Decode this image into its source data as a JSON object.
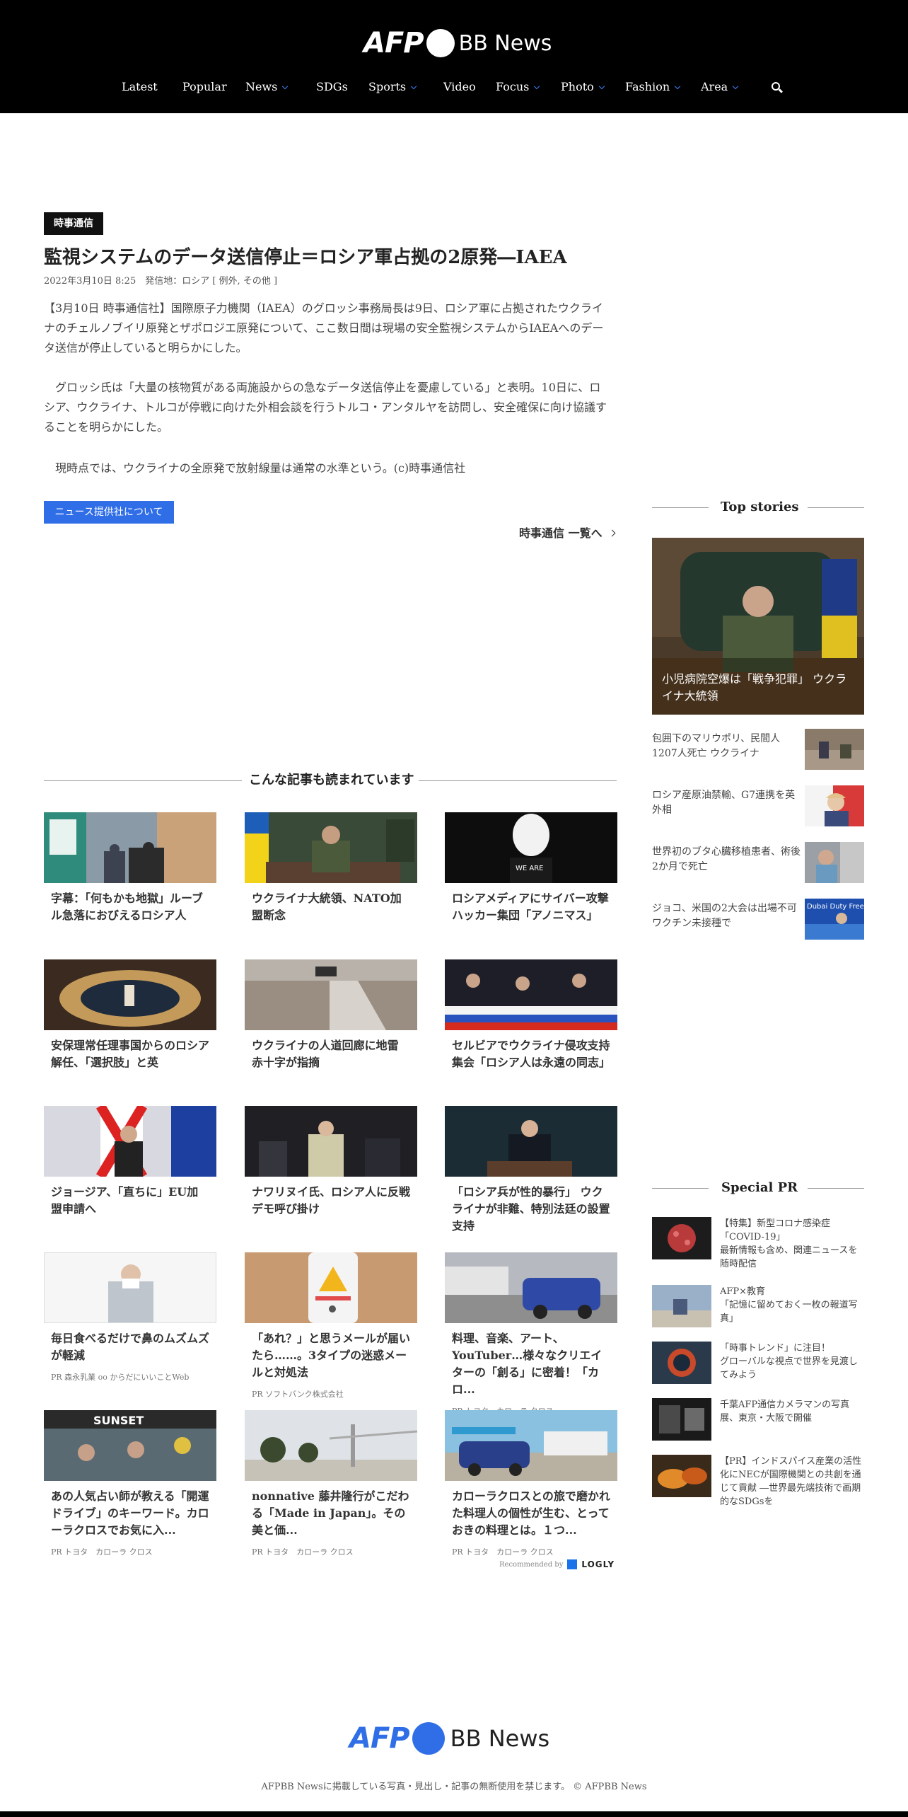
{
  "header": {
    "logo": {
      "afp": "AFP",
      "bb": "BB News"
    },
    "nav": [
      {
        "label": "Latest",
        "dropdown": false
      },
      {
        "label": "Popular",
        "dropdown": false
      },
      {
        "label": "News",
        "dropdown": true
      },
      {
        "label": "SDGs",
        "dropdown": false
      },
      {
        "label": "Sports",
        "dropdown": true
      },
      {
        "label": "Video",
        "dropdown": false
      },
      {
        "label": "Focus",
        "dropdown": true
      },
      {
        "label": "Photo",
        "dropdown": true
      },
      {
        "label": "Fashion",
        "dropdown": true
      },
      {
        "label": "Area",
        "dropdown": true
      }
    ],
    "search_icon": "search-icon"
  },
  "article": {
    "source_badge": "時事通信",
    "title": "監視システムのデータ送信停止＝ロシア軍占拠の2原発―IAEA",
    "meta": "2022年3月10日 8:25　発信地：ロシア [ 例外, その他 ]",
    "paragraphs": [
      "【3月10日 時事通信社】国際原子力機関（IAEA）のグロッシ事務局長は9日、ロシア軍に占拠されたウクライナのチェルノブイリ原発とザポロジエ原発について、ここ数日間は現場の安全監視システムからIAEAへのデータ送信が停止していると明らかにした。",
      "　グロッシ氏は「大量の核物質がある両施設からの急なデータ送信停止を憂慮している」と表明。10日に、ロシア、ウクライナ、トルコが停戦に向けた外相会談を行うトルコ・アンタルヤを訪問し、安全確保に向け協議することを明らかにした。",
      "　現時点では、ウクライナの全原発で放射線量は通常の水準という。(c)時事通信社"
    ],
    "provider_button": "ニュース提供社について",
    "more_link": "時事通信 一覧へ"
  },
  "related": {
    "heading": "こんな記事も読まれています",
    "items": [
      {
        "title": "字幕：「何もかも地獄」ルーブル急落におびえるロシア人",
        "sponsor": ""
      },
      {
        "title": "ウクライナ大統領、NATO加盟断念",
        "sponsor": ""
      },
      {
        "title": "ロシアメディアにサイバー攻撃 ハッカー集団「アノニマス」",
        "sponsor": ""
      },
      {
        "title": "安保理常任理事国からのロシア解任、「選択肢」と英",
        "sponsor": ""
      },
      {
        "title": "ウクライナの人道回廊に地雷 赤十字が指摘",
        "sponsor": ""
      },
      {
        "title": "セルビアでウクライナ侵攻支持集会「ロシア人は永遠の同志」",
        "sponsor": ""
      },
      {
        "title": "ジョージア、「直ちに」EU加盟申請へ",
        "sponsor": ""
      },
      {
        "title": "ナワリヌイ氏、ロシア人に反戦デモ呼び掛け",
        "sponsor": ""
      },
      {
        "title": "「ロシア兵が性的暴行」 ウクライナが非難、特別法廷の設置支持",
        "sponsor": ""
      },
      {
        "title": "毎日食べるだけで鼻のムズムズが軽減",
        "sponsor": "PR 森永乳業 oo からだにいいことWeb"
      },
      {
        "title": "「あれ？」と思うメールが届いたら……。3タイプの迷惑メールと対処法",
        "sponsor": "PR ソフトバンク株式会社"
      },
      {
        "title": "料理、音楽、アート、YouTuber…様々なクリエイターの「創る」に密着！「カロ...",
        "sponsor": "PR トヨタ　カローラ クロス"
      },
      {
        "title": "あの人気占い師が教える「開運ドライブ」のキーワード。カローラクロスでお気に入...",
        "sponsor": "PR トヨタ　カローラ クロス"
      },
      {
        "title": "nonnative 藤井隆行がこだわる「Made in Japan」。その美と価...",
        "sponsor": "PR トヨタ　カローラ クロス"
      },
      {
        "title": "カローラクロスとの旅で磨かれた料理人の個性が生む、とっておきの料理とは。１つ...",
        "sponsor": "PR トヨタ　カローラ クロス"
      }
    ],
    "recommended_by": "Recommended by",
    "logly": "LOGLY"
  },
  "sidebar": {
    "top_heading": "Top stories",
    "top_story_caption": "小児病院空爆は「戦争犯罪」 ウクライナ大統領",
    "stories": [
      "包囲下のマリウポリ、民間人1207人死亡 ウクライナ",
      "ロシア産原油禁輸、G7連携を英外相",
      "世界初のブタ心臓移植患者、術後2か月で死亡",
      "ジョコ、米国の2大会は出場不可 ワクチン未接種で"
    ],
    "pr_heading": "Special PR",
    "pr": [
      "【特集】新型コロナ感染症「COVID-19」\n最新情報も含め、関連ニュースを随時配信",
      "AFP×教育\n「記憶に留めておく一枚の報道写真」",
      "「時事トレンド」に注目！\nグローバルな視点で世界を見渡してみよう",
      "千葉AFP通信カメラマンの写真展、東京・大阪で開催",
      "【PR】インドスパイス産業の活性化にNECが国際機関との共創を通じて貢献 ―世界最先端技術で画期的なSDGsを"
    ],
    "duty_free_text": "Dubai Duty Free"
  },
  "footer": {
    "logo_afp": "AFP",
    "logo_bb": "BB News",
    "copyright": "AFPBB Newsに掲載している写真・見出し・記事の無断使用を禁じます。 © AFPBB News"
  }
}
